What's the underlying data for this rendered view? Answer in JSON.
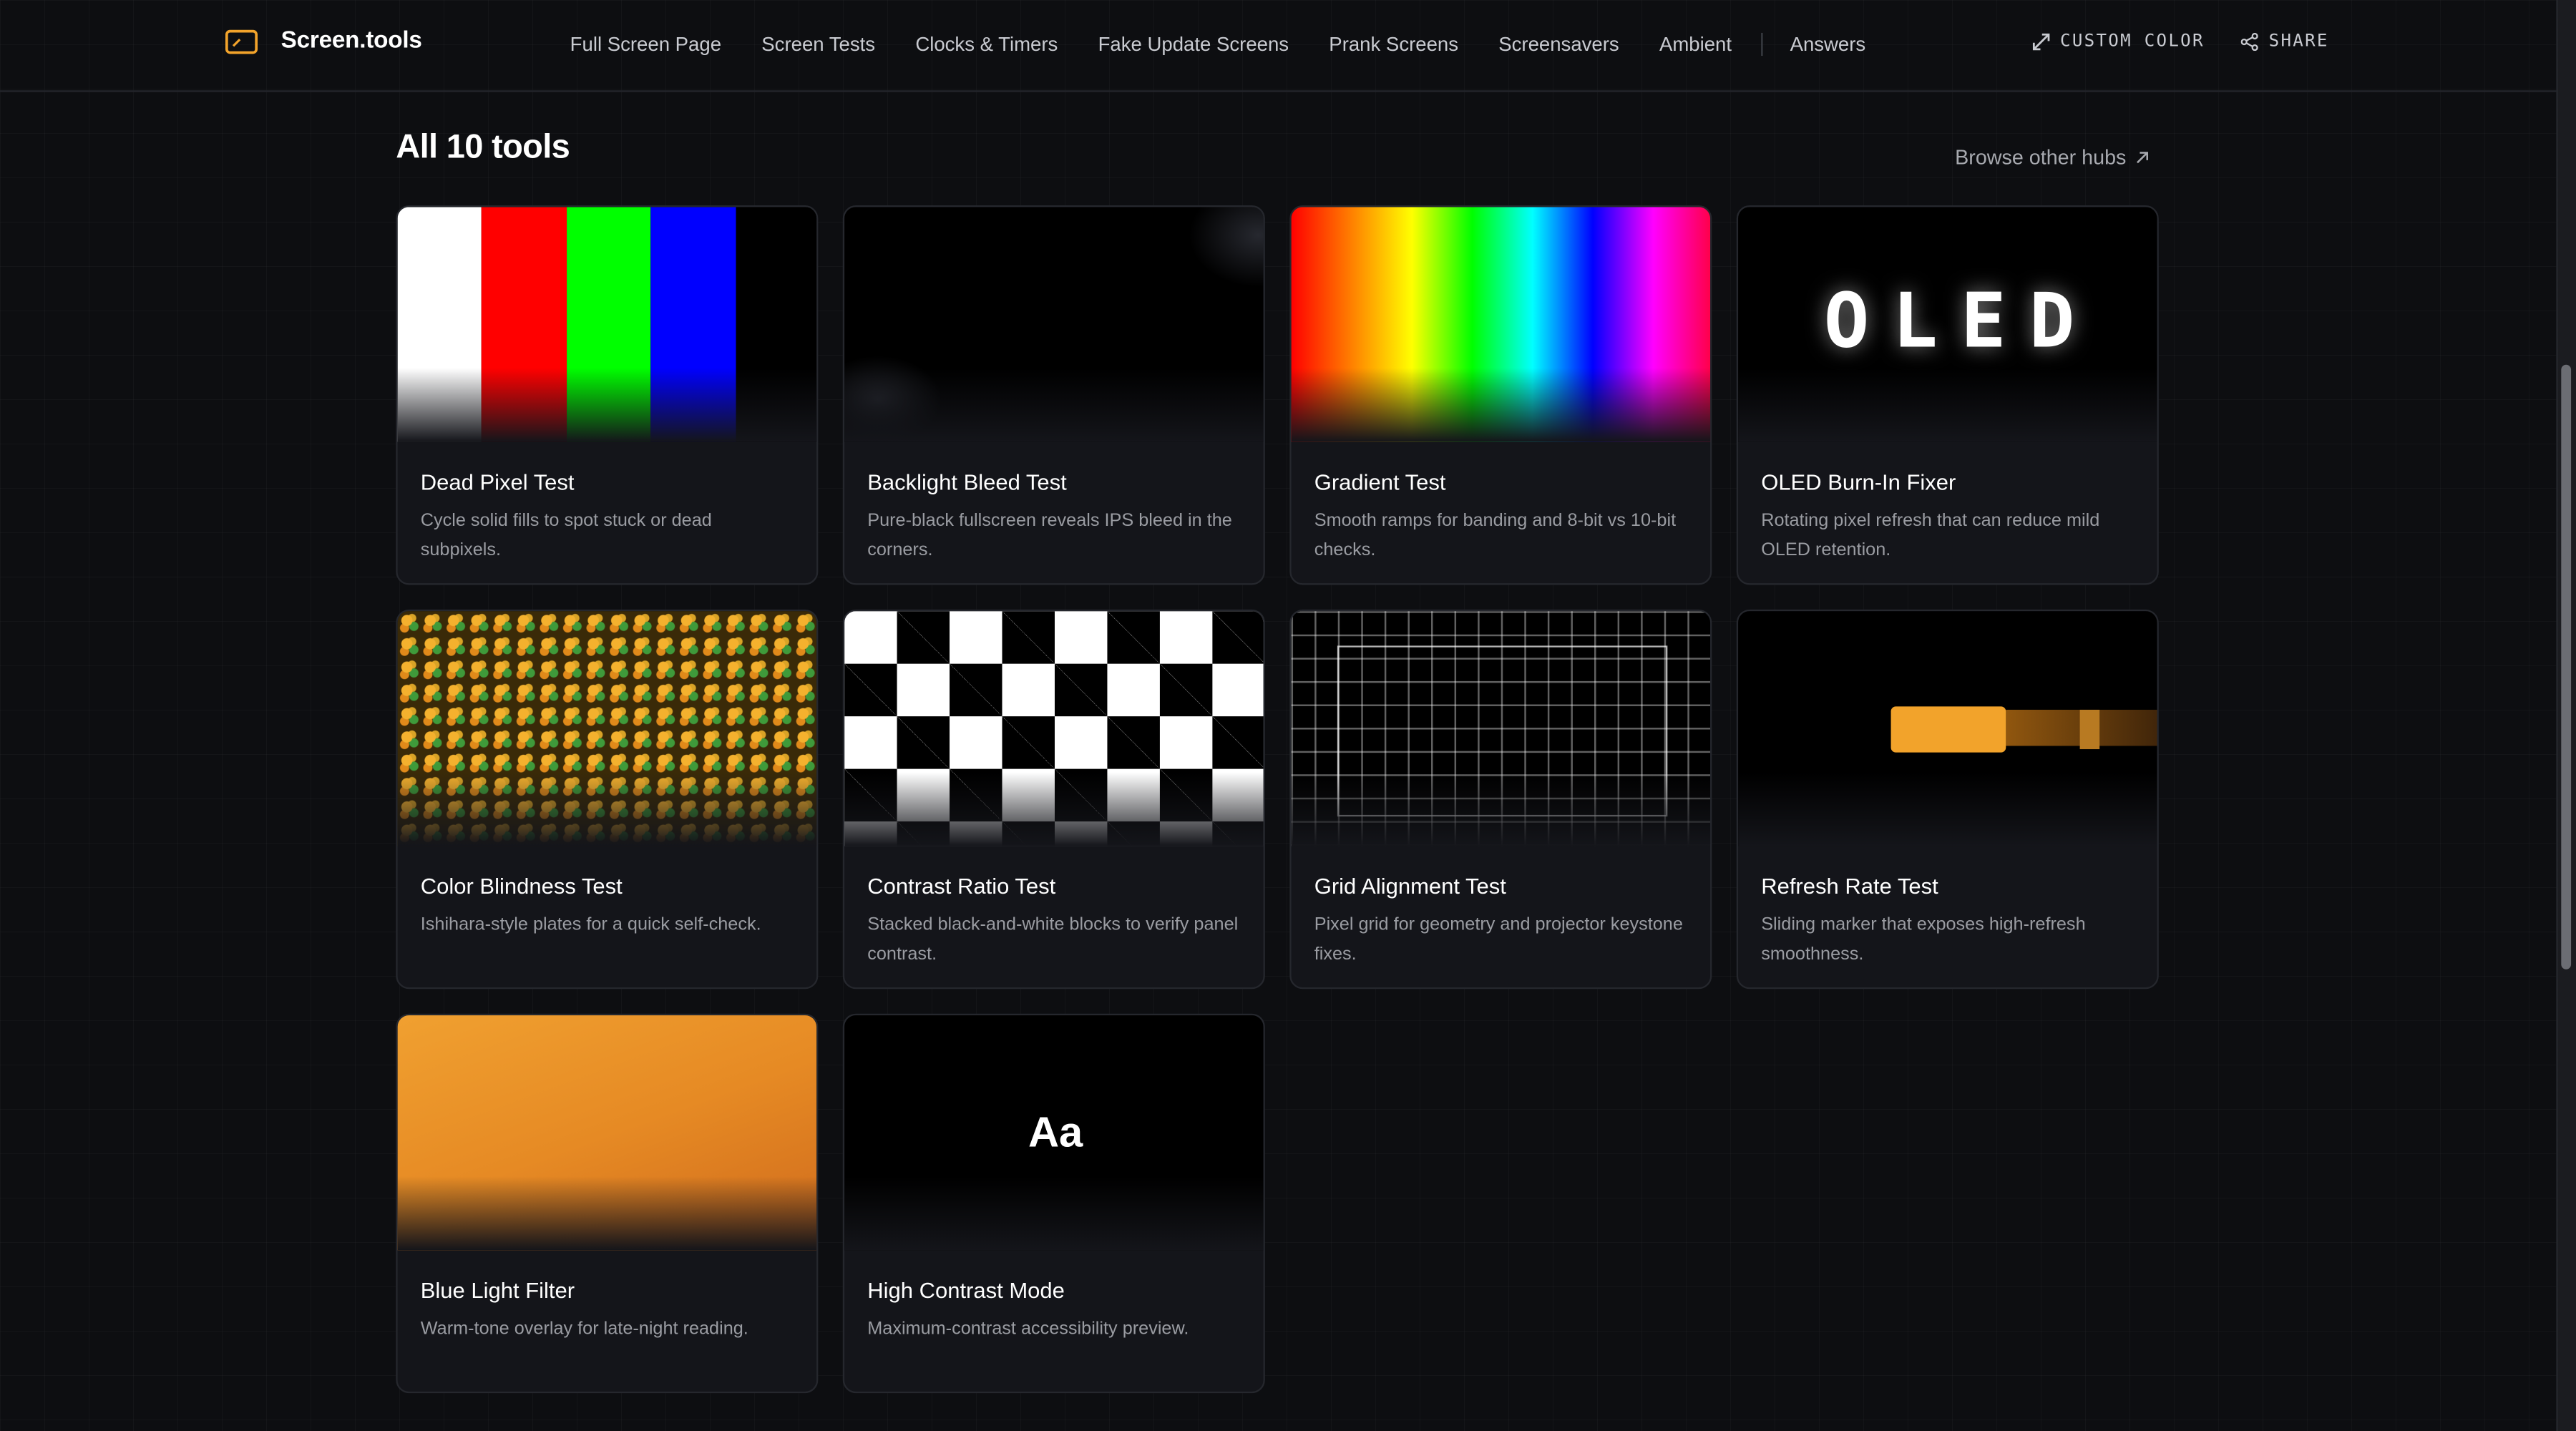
{
  "header": {
    "brand": "Screen.tools",
    "nav": [
      "Full Screen Page",
      "Screen Tests",
      "Clocks & Timers",
      "Fake Update Screens",
      "Prank Screens",
      "Screensavers",
      "Ambient",
      "Answers"
    ],
    "custom_color": "CUSTOM COLOR",
    "share": "SHARE"
  },
  "section": {
    "title": "All 10 tools",
    "browse_link": "Browse other hubs"
  },
  "cards": [
    {
      "title": "Dead Pixel Test",
      "description": "Cycle solid fills to spot stuck or dead subpixels."
    },
    {
      "title": "Backlight Bleed Test",
      "description": "Pure-black fullscreen reveals IPS bleed in the corners."
    },
    {
      "title": "Gradient Test",
      "description": "Smooth ramps for banding and 8-bit vs 10-bit checks."
    },
    {
      "title": "OLED Burn-In Fixer",
      "description": "Rotating pixel refresh that can reduce mild OLED retention.",
      "preview_text": "OLED"
    },
    {
      "title": "Color Blindness Test",
      "description": "Ishihara-style plates for a quick self-check."
    },
    {
      "title": "Contrast Ratio Test",
      "description": "Stacked black-and-white blocks to verify panel contrast."
    },
    {
      "title": "Grid Alignment Test",
      "description": "Pixel grid for geometry and projector keystone fixes."
    },
    {
      "title": "Refresh Rate Test",
      "description": "Sliding marker that exposes high-refresh smoothness."
    },
    {
      "title": "Blue Light Filter",
      "description": "Warm-tone overlay for late-night reading."
    },
    {
      "title": "High Contrast Mode",
      "description": "Maximum-contrast accessibility preview.",
      "preview_text": "Aa"
    }
  ],
  "colors": {
    "accent": "#f2a32b",
    "background": "#0d0e11",
    "card": "#14151a",
    "dead_pixel_bars": [
      "#ffffff",
      "#ff0000",
      "#00ff00",
      "#0000ff",
      "#000000"
    ]
  }
}
